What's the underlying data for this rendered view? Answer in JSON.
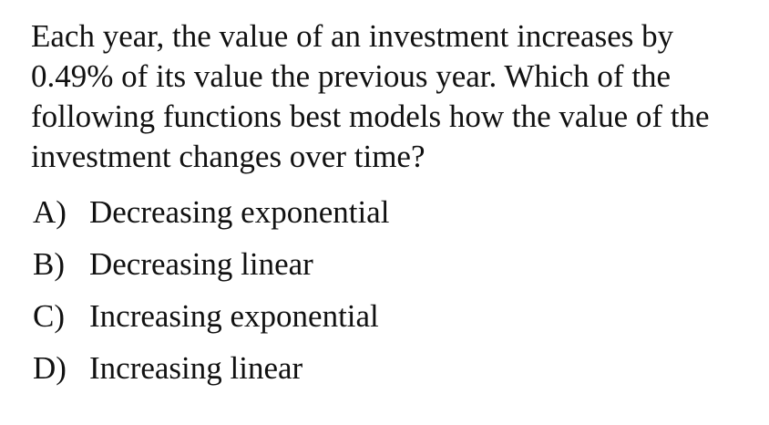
{
  "question": {
    "lines": [
      "Each year, the value of an investment increases by",
      "0.49% of its value the previous year. Which of the",
      "following functions best models how the value of the",
      "investment changes over time?"
    ]
  },
  "choices": [
    {
      "letter": "A)",
      "text": "Decreasing exponential"
    },
    {
      "letter": "B)",
      "text": "Decreasing linear"
    },
    {
      "letter": "C)",
      "text": "Increasing exponential"
    },
    {
      "letter": "D)",
      "text": "Increasing linear"
    }
  ]
}
